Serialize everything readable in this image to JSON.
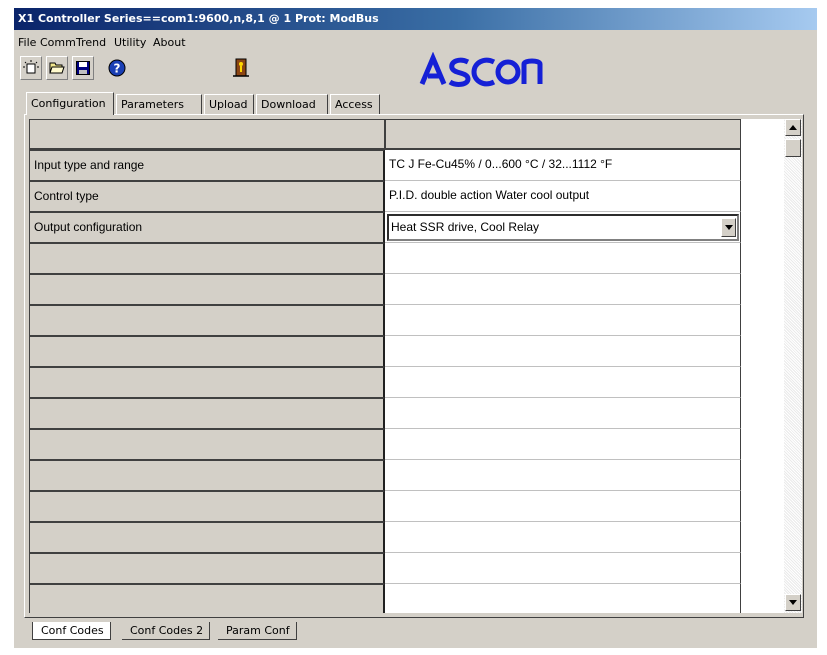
{
  "window": {
    "title": "X1 Controller Series==com1:9600,n,8,1 @ 1 Prot: ModBus"
  },
  "menu": [
    "File",
    "Comm",
    "Trend",
    "Utility",
    "About"
  ],
  "toolbar": {
    "buttons": [
      "new-icon",
      "open-folder-icon",
      "save-icon",
      "help-icon",
      "exit-door-icon"
    ]
  },
  "logo": {
    "text": "ASCON",
    "color": "#1520d6"
  },
  "tabs": [
    "Configuration",
    "Parameters",
    "Upload",
    "Download",
    "Access"
  ],
  "grid": {
    "header": [
      "",
      ""
    ],
    "rows": [
      {
        "label": "Input type and range",
        "value": "TC J Fe-Cu45% / 0...600 °C / 32...1112 °F"
      },
      {
        "label": "Control type",
        "value": "P.I.D. double action Water cool output"
      },
      {
        "label": "Output configuration",
        "value": "Heat SSR drive, Cool Relay"
      }
    ],
    "empty_rows": 12
  },
  "bottom_tabs": [
    "Conf Codes",
    "Conf Codes 2",
    "Param Conf"
  ]
}
